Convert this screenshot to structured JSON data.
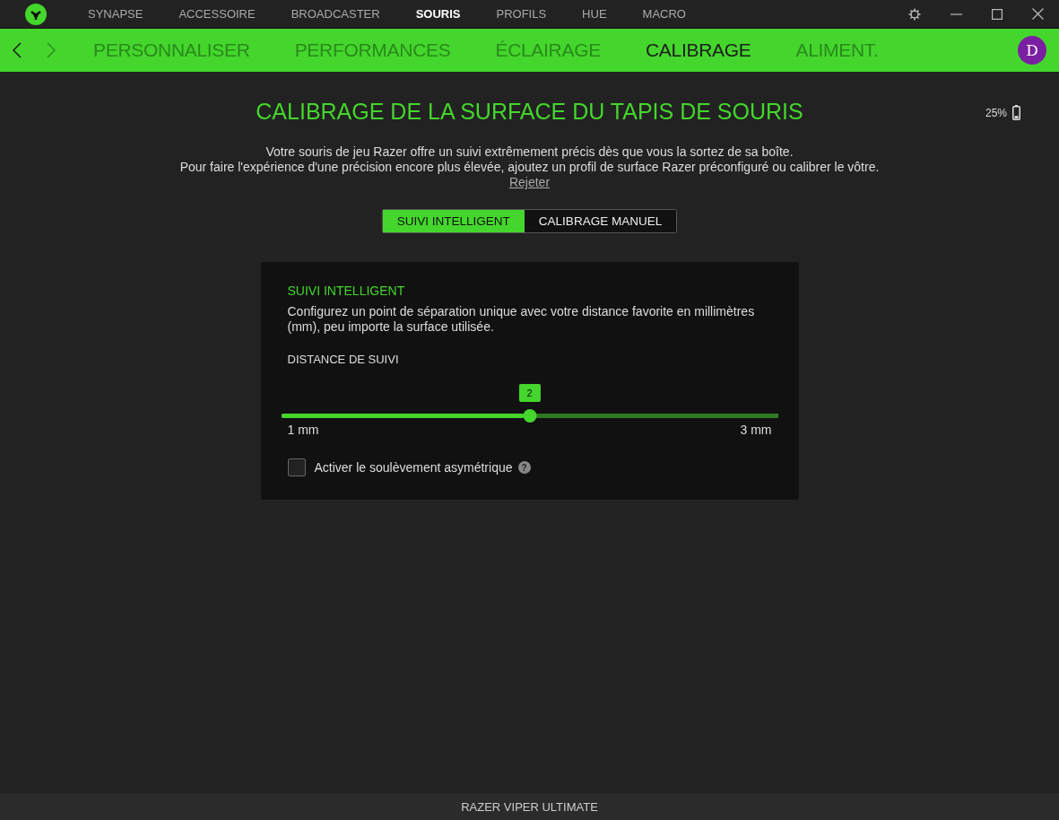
{
  "top_tabs": [
    {
      "label": "SYNAPSE",
      "selected": false
    },
    {
      "label": "ACCESSOIRE",
      "selected": false
    },
    {
      "label": "BROADCASTER",
      "selected": false
    },
    {
      "label": "SOURIS",
      "selected": true
    },
    {
      "label": "PROFILS",
      "selected": false
    },
    {
      "label": "HUE",
      "selected": false
    },
    {
      "label": "MACRO",
      "selected": false
    }
  ],
  "sub_tabs": [
    {
      "label": "PERSONNALISER",
      "selected": false
    },
    {
      "label": "PERFORMANCES",
      "selected": false
    },
    {
      "label": "ÉCLAIRAGE",
      "selected": false
    },
    {
      "label": "CALIBRAGE",
      "selected": true
    },
    {
      "label": "ALIMENT.",
      "selected": false
    }
  ],
  "avatar": "D",
  "battery": {
    "reading": "25%",
    "level": 0.25
  },
  "title": "CALIBRAGE DE LA SURFACE DU TAPIS DE SOURIS",
  "intro": [
    "Votre souris de jeu Razer offre un suivi extrêmement précis dès que vous la sortez de sa boîte.",
    "Pour faire l'expérience d'une précision encore plus élevée, ajoutez un profil de surface Razer préconfiguré ou calibrer le vôtre."
  ],
  "dismiss_link": "Rejeter",
  "mode_tabs": [
    {
      "label": "SUIVI INTELLIGENT",
      "selected": true
    },
    {
      "label": "CALIBRAGE MANUEL",
      "selected": false
    }
  ],
  "card": {
    "heading": "SUIVI INTELLIGENT",
    "description": "Configurez un point de séparation unique avec votre distance favorite en millimètres (mm), peu importe la surface utilisée.",
    "slider_label": "DISTANCE DE SUIVI",
    "slider": {
      "value": "2",
      "level": 0.5,
      "min_label": "1 mm",
      "max_label": "3 mm"
    },
    "checkbox": {
      "label": "Activer le soulèvement asymétrique",
      "checked": false,
      "help_glyph": "?"
    }
  },
  "status_bar": "RAZER VIPER ULTIMATE"
}
